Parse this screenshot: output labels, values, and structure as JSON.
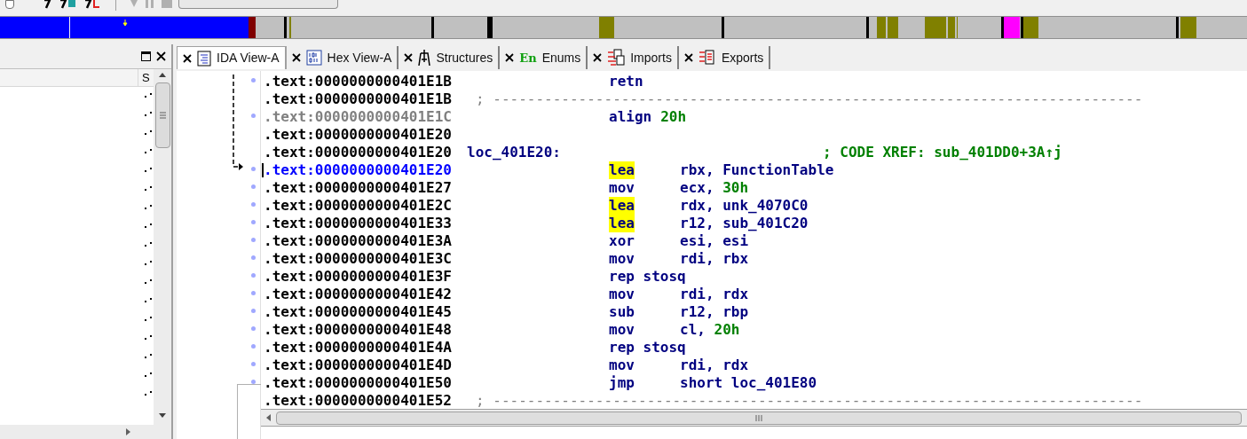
{
  "left_panel": {
    "column_header": "S"
  },
  "tabs": [
    {
      "label": "IDA View-A",
      "selected": true
    },
    {
      "label": "Hex View-A",
      "selected": false
    },
    {
      "label": "Structures",
      "selected": false
    },
    {
      "label": "Enums",
      "icon_text": "En",
      "selected": false
    },
    {
      "label": "Imports",
      "selected": false
    },
    {
      "label": "Exports",
      "selected": false
    }
  ],
  "lines": [
    {
      "kind": "instr",
      "address": ".text:0000000000401E1B",
      "current": false,
      "dimmed": false,
      "mnemonic": "retn",
      "highlighted": false
    },
    {
      "kind": "separator",
      "address": ".text:0000000000401E1B",
      "current": false,
      "dimmed": false,
      "separator": "; ----------------------------------------------------------------------------"
    },
    {
      "kind": "directive",
      "address": ".text:0000000000401E1C",
      "current": false,
      "dimmed": true,
      "mnemonic": "align",
      "highlighted": false,
      "operands": [
        {
          "text": "20h",
          "kind": "number"
        }
      ]
    },
    {
      "kind": "blank",
      "address": ".text:0000000000401E20",
      "current": false,
      "dimmed": false
    },
    {
      "kind": "label",
      "address": ".text:0000000000401E20",
      "current": false,
      "dimmed": false,
      "label": "loc_401E20:",
      "comment": "; CODE XREF: sub_401DD0+3A↑j"
    },
    {
      "kind": "instr",
      "address": ".text:0000000000401E20",
      "current": true,
      "dimmed": false,
      "mnemonic": "lea",
      "highlighted": true,
      "operands": [
        {
          "text": "rbx, FunctionTable",
          "kind": "plain"
        }
      ]
    },
    {
      "kind": "instr",
      "address": ".text:0000000000401E27",
      "current": false,
      "dimmed": false,
      "mnemonic": "mov",
      "highlighted": false,
      "operands": [
        {
          "text": "ecx, ",
          "kind": "plain"
        },
        {
          "text": "30h",
          "kind": "number"
        }
      ]
    },
    {
      "kind": "instr",
      "address": ".text:0000000000401E2C",
      "current": false,
      "dimmed": false,
      "mnemonic": "lea",
      "highlighted": true,
      "operands": [
        {
          "text": "rdx, unk_4070C0",
          "kind": "plain"
        }
      ]
    },
    {
      "kind": "instr",
      "address": ".text:0000000000401E33",
      "current": false,
      "dimmed": false,
      "mnemonic": "lea",
      "highlighted": true,
      "operands": [
        {
          "text": "r12, sub_401C20",
          "kind": "plain"
        }
      ]
    },
    {
      "kind": "instr",
      "address": ".text:0000000000401E3A",
      "current": false,
      "dimmed": false,
      "mnemonic": "xor",
      "highlighted": false,
      "operands": [
        {
          "text": "esi, esi",
          "kind": "plain"
        }
      ]
    },
    {
      "kind": "instr",
      "address": ".text:0000000000401E3C",
      "current": false,
      "dimmed": false,
      "mnemonic": "mov",
      "highlighted": false,
      "operands": [
        {
          "text": "rdi, rbx",
          "kind": "plain"
        }
      ]
    },
    {
      "kind": "instr",
      "address": ".text:0000000000401E3F",
      "current": false,
      "dimmed": false,
      "mnemonic": "rep stosq",
      "highlighted": false
    },
    {
      "kind": "instr",
      "address": ".text:0000000000401E42",
      "current": false,
      "dimmed": false,
      "mnemonic": "mov",
      "highlighted": false,
      "operands": [
        {
          "text": "rdi, rdx",
          "kind": "plain"
        }
      ]
    },
    {
      "kind": "instr",
      "address": ".text:0000000000401E45",
      "current": false,
      "dimmed": false,
      "mnemonic": "sub",
      "highlighted": false,
      "operands": [
        {
          "text": "r12, rbp",
          "kind": "plain"
        }
      ]
    },
    {
      "kind": "instr",
      "address": ".text:0000000000401E48",
      "current": false,
      "dimmed": false,
      "mnemonic": "mov",
      "highlighted": false,
      "operands": [
        {
          "text": "cl, ",
          "kind": "plain"
        },
        {
          "text": "20h",
          "kind": "number"
        }
      ]
    },
    {
      "kind": "instr",
      "address": ".text:0000000000401E4A",
      "current": false,
      "dimmed": false,
      "mnemonic": "rep stosq",
      "highlighted": false
    },
    {
      "kind": "instr",
      "address": ".text:0000000000401E4D",
      "current": false,
      "dimmed": false,
      "mnemonic": "mov",
      "highlighted": false,
      "operands": [
        {
          "text": "rdi, rdx",
          "kind": "plain"
        }
      ]
    },
    {
      "kind": "instr",
      "address": ".text:0000000000401E50",
      "current": false,
      "dimmed": false,
      "mnemonic": "jmp",
      "highlighted": false,
      "operands": [
        {
          "text": "short loc_401E80",
          "kind": "plain"
        }
      ]
    },
    {
      "kind": "separator",
      "address": ".text:0000000000401E52",
      "current": false,
      "dimmed": false,
      "separator": "; ----------------------------------------------------------------------------"
    }
  ]
}
